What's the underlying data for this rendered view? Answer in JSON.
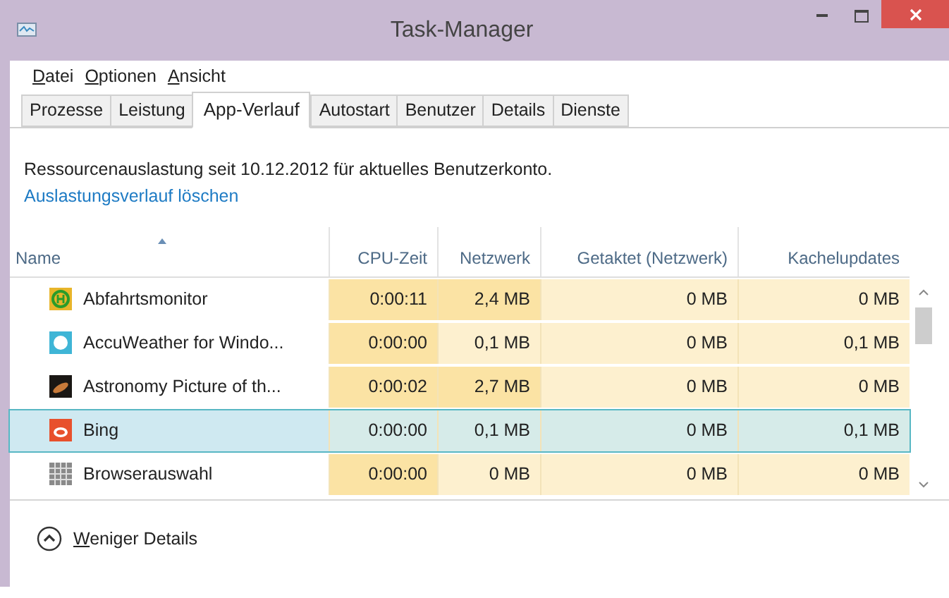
{
  "window": {
    "title": "Task-Manager"
  },
  "menu": [
    {
      "label": "Datei",
      "access_key_underlined": true
    },
    {
      "label": "Optionen",
      "access_key_underlined": true
    },
    {
      "label": "Ansicht",
      "access_key_underlined": true
    }
  ],
  "tabs": [
    {
      "label": "Prozesse",
      "selected": false
    },
    {
      "label": "Leistung",
      "selected": false
    },
    {
      "label": "App-Verlauf",
      "selected": true
    },
    {
      "label": "Autostart",
      "selected": false
    },
    {
      "label": "Benutzer",
      "selected": false
    },
    {
      "label": "Details",
      "selected": false
    },
    {
      "label": "Dienste",
      "selected": false
    }
  ],
  "info": {
    "text": "Ressourcenauslastung seit 10.12.2012 für aktuelles Benutzerkonto.",
    "link": "Auslastungsverlauf löschen"
  },
  "table": {
    "columns": [
      "Name",
      "CPU-Zeit",
      "Netzwerk",
      "Getaktet (Netzwerk)",
      "Kachelupdates"
    ],
    "rows": [
      {
        "selected": false,
        "cells": [
          {
            "text": "Abfahrtsmonitor"
          },
          {
            "text": "0:00:11",
            "color": "#fbe3a4"
          },
          {
            "text": "2,4 MB",
            "color": "#fbe3a4"
          },
          {
            "text": "0 MB",
            "color": "#fdf0cf"
          },
          {
            "text": "0 MB",
            "color": "#fdf0cf"
          }
        ]
      },
      {
        "selected": false,
        "cells": [
          {
            "text": "AccuWeather for Windo..."
          },
          {
            "text": "0:00:00",
            "color": "#fbe3a4"
          },
          {
            "text": "0,1 MB",
            "color": "#fdf0cf"
          },
          {
            "text": "0 MB",
            "color": "#fdf0cf"
          },
          {
            "text": "0,1 MB",
            "color": "#fdf0cf"
          }
        ]
      },
      {
        "selected": false,
        "cells": [
          {
            "text": "Astronomy Picture of th..."
          },
          {
            "text": "0:00:02",
            "color": "#fbe3a4"
          },
          {
            "text": "2,7 MB",
            "color": "#fbe3a4"
          },
          {
            "text": "0 MB",
            "color": "#fdf0cf"
          },
          {
            "text": "0 MB",
            "color": "#fdf0cf"
          }
        ]
      },
      {
        "selected": true,
        "cells": [
          {
            "text": "Bing"
          },
          {
            "text": "0:00:00"
          },
          {
            "text": "0,1 MB"
          },
          {
            "text": "0 MB"
          },
          {
            "text": "0,1 MB"
          }
        ]
      },
      {
        "selected": false,
        "cells": [
          {
            "text": "Browserauswahl"
          },
          {
            "text": "0:00:00",
            "color": "#fbe3a4"
          },
          {
            "text": "0 MB",
            "color": "#fdf0cf"
          },
          {
            "text": "0 MB",
            "color": "#fdf0cf"
          },
          {
            "text": "0 MB",
            "color": "#fdf0cf"
          }
        ]
      }
    ]
  },
  "footer": {
    "label": "Weniger Details",
    "access_key_underlined": true
  }
}
